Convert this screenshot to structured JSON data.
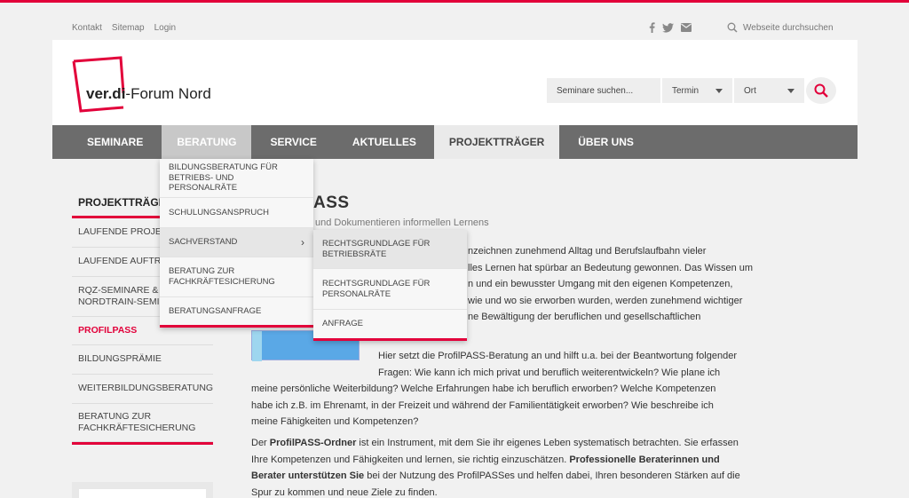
{
  "util": {
    "links": [
      "Kontakt",
      "Sitemap",
      "Login"
    ],
    "search_placeholder": "Webseite durchsuchen"
  },
  "logo": {
    "text_bold": "ver.di",
    "text_rest": "-Forum Nord"
  },
  "header_search": {
    "placeholder": "Seminare suchen...",
    "termin": "Termin",
    "ort": "Ort"
  },
  "nav": [
    "SEMINARE",
    "BERATUNG",
    "SERVICE",
    "AKTUELLES",
    "PROJEKTTRÄGER",
    "ÜBER UNS"
  ],
  "sidebar": {
    "title": "PROJEKTTRÄGER",
    "items": [
      "LAUFENDE PROJEKTE",
      "LAUFENDE AUFTRÄGE",
      "RQZ-SEMINARE & NORDTRAIN-SEMINARE",
      "PROFILPASS",
      "BILDUNGSPRÄMIE",
      "WEITERBILDUNGSBERATUNG",
      "BERATUNG ZUR FACHKRÄFTESICHERUNG"
    ]
  },
  "dropdown_beratung": [
    "BILDUNGSBERATUNG FÜR BETRIEBS- UND PERSONALRÄTE",
    "SCHULUNGSANSPRUCH",
    "SACHVERSTAND",
    "BERATUNG ZUR FACHKRÄFTESICHERUNG",
    "BERATUNGSANFRAGE"
  ],
  "dropdown_sachverstand": [
    "RECHTSGRUNDLAGE FÜR BETRIEBSRÄTE",
    "RECHTSGRUNDLAGE FÜR PERSONALRÄTE",
    "ANFRAGE"
  ],
  "content": {
    "heading": "ASS",
    "subheading": "und Dokumentieren informellen Lernens",
    "p1_lines": [
      "nzeichnen zunehmend Alltag und Berufslaufbahn vieler",
      "lles Lernen hat spürbar an Bedeutung gewonnen. Das Wissen um",
      "n und ein bewusster Umgang mit den eigenen Kompetenzen,",
      "wie und wo sie erworben wurden, werden zunehmend wichtiger",
      "ne Bewältigung der beruflichen und gesellschaftlichen"
    ],
    "p2_first_lines": [
      "Hier setzt die ProfilPASS-Beratung an und hilft u.a. bei der Beantwortung folgender",
      "Fragen: Wie kann ich mich privat und beruflich weiterentwickeln? Wie plane ich"
    ],
    "p2_lines": [
      "meine persönliche Weiterbildung? Welche Erfahrungen habe ich beruflich erworben? Welche Kompetenzen",
      "habe ich z.B. im Ehrenamt, in der Freizeit und während der Familientätigkeit erworben? Wie beschreibe ich",
      "meine Fähigkeiten und Kompetenzen?"
    ],
    "p3": {
      "a": "Der ",
      "b": "ProfilPASS-Ordner",
      "c": " ist ein Instrument, mit dem Sie ihr eigenes Leben systematisch betrachten. Sie erfassen",
      "d": "Ihre Kompetenzen und Fähigkeiten und lernen, sie richtig einzuschätzen. ",
      "e": "Professionelle Beraterinnen und",
      "f": "Berater unterstützen Sie",
      "g": " bei der Nutzung des ProfilPASSes und helfen dabei, Ihren besonderen Stärken auf die",
      "h": "Spur zu kommen und neue Ziele zu finden."
    }
  },
  "colors": {
    "accent": "#e2003a",
    "nav_bg": "#6c6c6c"
  }
}
